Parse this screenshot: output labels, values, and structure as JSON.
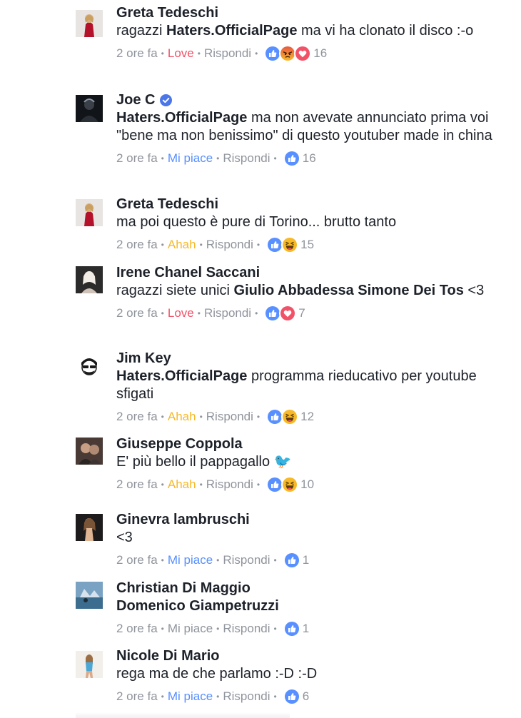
{
  "time_label": "2 ore fa",
  "reply_label": "Rispondi",
  "comments": [
    {
      "author": "Greta Tedeschi",
      "verified": false,
      "text": [
        {
          "t": "ragazzi "
        },
        {
          "t": "Haters.OfficialPage",
          "b": true
        },
        {
          "t": " ma vi ha clonato il disco :-o"
        }
      ],
      "like_label": "Love",
      "like_state": "love",
      "reactions": [
        "like-icon",
        "angry-icon",
        "love-icon"
      ],
      "count": "16",
      "avatar_icon": "avatar-greta"
    },
    {
      "author": "Joe C",
      "verified": true,
      "text": [
        {
          "t": "Haters.OfficialPage",
          "b": true
        },
        {
          "t": " ma non avevate annunciato prima voi \"bene ma non benissimo\" di questo youtuber made in china"
        }
      ],
      "like_label": "Mi piace",
      "like_state": "liked",
      "reactions": [
        "like-icon"
      ],
      "count": "16",
      "avatar_icon": "avatar-joe"
    },
    {
      "author": "Greta Tedeschi",
      "verified": false,
      "text": [
        {
          "t": "ma poi questo è pure di Torino... brutto tanto"
        }
      ],
      "like_label": "Ahah",
      "like_state": "haha",
      "reactions": [
        "like-icon",
        "haha-icon"
      ],
      "count": "15",
      "avatar_icon": "avatar-greta"
    },
    {
      "author": "Irene Chanel Saccani",
      "verified": false,
      "text": [
        {
          "t": "ragazzi siete unici "
        },
        {
          "t": "Giulio Abbadessa",
          "b": true
        },
        {
          "t": " "
        },
        {
          "t": "Simone Dei Tos",
          "b": true
        },
        {
          "t": " <3"
        }
      ],
      "like_label": "Love",
      "like_state": "love",
      "reactions": [
        "like-icon",
        "love-icon"
      ],
      "count": "7",
      "avatar_icon": "avatar-irene"
    },
    {
      "author": "Jim Key",
      "verified": false,
      "text": [
        {
          "t": "Haters.OfficialPage",
          "b": true
        },
        {
          "t": " programma rieducativo per youtube sfigati"
        }
      ],
      "like_label": "Ahah",
      "like_state": "haha",
      "reactions": [
        "like-icon",
        "haha-icon"
      ],
      "count": "12",
      "avatar_icon": "avatar-jim"
    },
    {
      "author": "Giuseppe Coppola",
      "verified": false,
      "text": [
        {
          "t": "E' più bello il pappagallo 🐦"
        }
      ],
      "like_label": "Ahah",
      "like_state": "haha",
      "reactions": [
        "like-icon",
        "haha-icon"
      ],
      "count": "10",
      "avatar_icon": "avatar-giuseppe"
    },
    {
      "author": "Ginevra lambruschi",
      "verified": false,
      "text": [
        {
          "t": "<3"
        }
      ],
      "like_label": "Mi piace",
      "like_state": "liked",
      "reactions": [
        "like-icon"
      ],
      "count": "1",
      "avatar_icon": "avatar-ginevra"
    },
    {
      "author": "Christian Di Maggio",
      "verified": false,
      "text": [
        {
          "t": "Domenico Giampetruzzi",
          "b": true
        }
      ],
      "like_label": "Mi piace",
      "like_state": "",
      "reactions": [
        "like-icon"
      ],
      "count": "1",
      "avatar_icon": "avatar-christian"
    },
    {
      "author": "Nicole Di Mario",
      "verified": false,
      "text": [
        {
          "t": "rega ma de che parlamo :-D :-D"
        }
      ],
      "like_label": "Mi piace",
      "like_state": "liked",
      "reactions": [
        "like-icon"
      ],
      "count": "6",
      "avatar_icon": "avatar-nicole"
    }
  ],
  "colors": {
    "like_blue": "#5890ff",
    "love_red": "#f25268",
    "haha_yellow": "#f7b928",
    "meta_gray": "#90949c",
    "text_dark": "#1d2129"
  }
}
